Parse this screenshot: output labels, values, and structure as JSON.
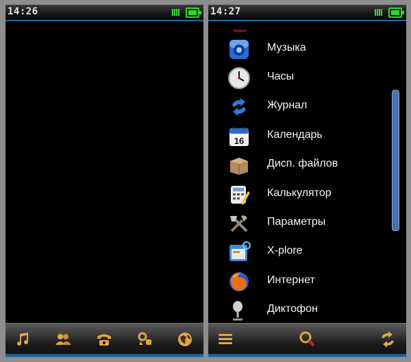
{
  "screen1": {
    "time": "14:26",
    "softkeys": [
      "music-icon",
      "contacts-icon",
      "phone-icon",
      "apps-icon",
      "internet-icon"
    ]
  },
  "screen2": {
    "time": "14:27",
    "menu": [
      {
        "label": "Музыка",
        "icon": "music-player-icon"
      },
      {
        "label": "Часы",
        "icon": "clock-icon"
      },
      {
        "label": "Журнал",
        "icon": "log-arrows-icon"
      },
      {
        "label": "Календарь",
        "icon": "calendar-icon"
      },
      {
        "label": "Дисп. файлов",
        "icon": "file-manager-box-icon"
      },
      {
        "label": "Калькулятор",
        "icon": "calculator-icon"
      },
      {
        "label": "Параметры",
        "icon": "settings-tools-icon"
      },
      {
        "label": "X-plore",
        "icon": "xplore-icon"
      },
      {
        "label": "Интернет",
        "icon": "firefox-icon"
      },
      {
        "label": "Диктофон",
        "icon": "microphone-icon"
      }
    ],
    "calendar_day": "16",
    "softkeys": [
      "menu-icon",
      "search-icon",
      "refresh-icon"
    ]
  },
  "colors": {
    "accent": "#e0a64a",
    "status_green": "#2ed82e",
    "bar_blue": "#2a7ab5"
  }
}
